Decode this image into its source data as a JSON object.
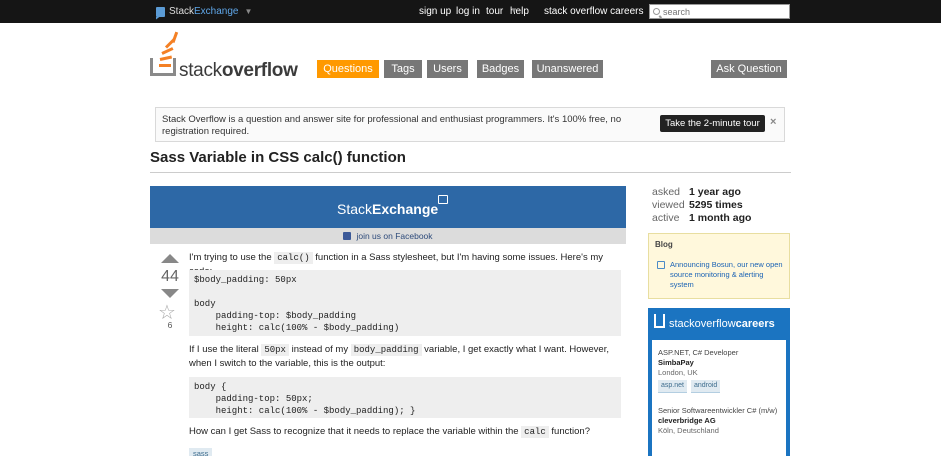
{
  "topbar": {
    "brand_prefix": "Stack",
    "brand_suffix": "Exchange",
    "links": [
      "sign up",
      "log in",
      "tour",
      "help",
      "stack overflow careers"
    ],
    "search_placeholder": "search"
  },
  "header": {
    "logo_text_light": "stack",
    "logo_text_bold": "overflow",
    "nav": [
      "Questions",
      "Tags",
      "Users",
      "Badges",
      "Unanswered"
    ],
    "active_nav": "Questions",
    "ask_button": "Ask Question"
  },
  "notice": {
    "message": "Stack Overflow is a question and answer site for professional and enthusiast programmers. It's 100% free, no registration required.",
    "tour_button": "Take the 2-minute tour",
    "close": "×"
  },
  "question": {
    "title": "Sass Variable in CSS calc() function",
    "votes": "44",
    "favorites": "6",
    "p1_a": "I'm trying to use the ",
    "p1_code": "calc()",
    "p1_b": " function in a Sass stylesheet, but I'm having some issues. Here's my code:",
    "code1": "$body_padding: 50px\n\nbody\n    padding-top: $body_padding\n    height: calc(100% - $body_padding)",
    "p2_a": "If I use the literal ",
    "p2_code1": "50px",
    "p2_b": " instead of my ",
    "p2_code2": "body_padding",
    "p2_c": " variable, I get exactly what I want. However, when I switch to the variable, this is the output:",
    "code2": "body {\n    padding-top: 50px;\n    height: calc(100% - $body_padding); }",
    "p3_a": "How can I get Sass to recognize that it needs to replace the variable within the ",
    "p3_code": "calc",
    "p3_b": " function?",
    "tag": "sass"
  },
  "ad": {
    "wordmark_light": "Stack",
    "wordmark_bold": "Exchange",
    "facebook_text": "join us on Facebook"
  },
  "stats": [
    {
      "label": "asked",
      "value": "1 year ago"
    },
    {
      "label": "viewed",
      "value": "5295 times"
    },
    {
      "label": "active",
      "value": "1 month ago"
    }
  ],
  "blog": {
    "heading": "Blog",
    "link": "Announcing Bosun, our new open source monitoring & alerting system"
  },
  "careers": {
    "title_light": "stackoverflow",
    "title_bold": "careers",
    "jobs": [
      {
        "title": "ASP.NET, C# Developer",
        "company": "SimbaPay",
        "location": "London, UK",
        "tags": [
          "asp.net",
          "android"
        ]
      },
      {
        "title": "Senior Softwareentwickler C# (m/w)",
        "company": "cleverbridge AG",
        "location": "Köln, Deutschland",
        "tags": []
      }
    ]
  },
  "colors": {
    "accent_orange": "#ff9900",
    "nav_gray": "#777777",
    "careers_blue": "#1b74c1",
    "ad_blue": "#2d68a6"
  }
}
